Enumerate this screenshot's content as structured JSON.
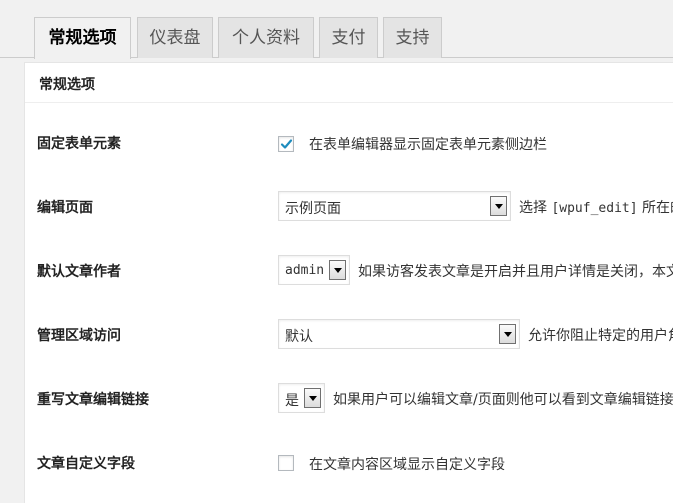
{
  "tabs": [
    {
      "label": "常规选项",
      "active": true
    },
    {
      "label": "仪表盘",
      "active": false
    },
    {
      "label": "个人资料",
      "active": false
    },
    {
      "label": "支付",
      "active": false
    },
    {
      "label": "支持",
      "active": false
    }
  ],
  "section_title": "常规选项",
  "fields": {
    "fixed_form": {
      "label": "固定表单元素",
      "checked": true,
      "description": "在表单编辑器显示固定表单元素侧边栏"
    },
    "edit_page": {
      "label": "编辑页面",
      "value": "示例页面",
      "description_prefix": "选择 ",
      "description_code": "[wpuf_edit]",
      "description_suffix": " 所在的"
    },
    "default_author": {
      "label": "默认文章作者",
      "value": "admin",
      "description": "如果访客发表文章是开启并且用户详情是关闭，本文"
    },
    "admin_access": {
      "label": "管理区域访问",
      "value": "默认",
      "description": "允许你阻止特定的用户角"
    },
    "override_edit_link": {
      "label": "重写文章编辑链接",
      "value": "是",
      "description": "如果用户可以编辑文章/页面则他可以看到文章编辑链接"
    },
    "custom_fields": {
      "label": "文章自定义字段",
      "checked": false,
      "description": "在文章内容区域显示自定义字段"
    }
  },
  "colors": {
    "checkmark": "#1e8cbe",
    "background": "#f1f1f1",
    "panel": "#ffffff"
  }
}
